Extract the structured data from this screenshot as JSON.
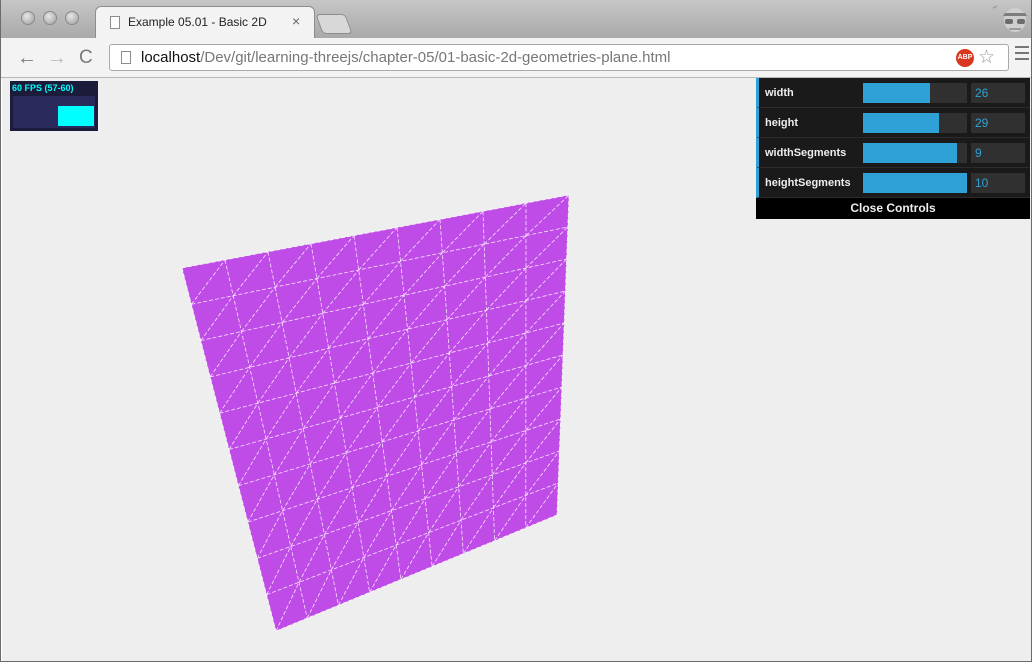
{
  "browser": {
    "tab": {
      "title": "Example 05.01 - Basic 2D",
      "close_glyph": "×"
    },
    "url": {
      "host": "localhost",
      "path": "/Dev/git/learning-threejs/chapter-05/01-basic-2d-geometries-plane.html"
    },
    "adblock_label": "ABP"
  },
  "stats": {
    "label": "60 FPS (57-60)",
    "color": "#00ffff"
  },
  "controls": {
    "items": [
      {
        "name": "width",
        "value": "26",
        "fill_fraction": 0.64
      },
      {
        "name": "height",
        "value": "29",
        "fill_fraction": 0.73
      },
      {
        "name": "widthSegments",
        "value": "9",
        "fill_fraction": 0.9
      },
      {
        "name": "heightSegments",
        "value": "10",
        "fill_fraction": 1.0
      }
    ],
    "close_label": "Close Controls",
    "accent": "#2fa1d6"
  },
  "scene": {
    "plane_color": "#c04ce8",
    "wireframe_color": "#ffffff",
    "background": "#eeeeee",
    "width_segments": 9,
    "height_segments": 10
  }
}
